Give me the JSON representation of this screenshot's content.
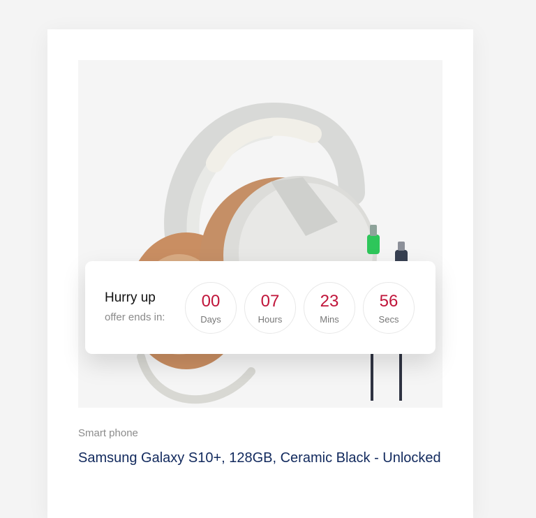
{
  "product": {
    "category": "Smart phone",
    "title": "Samsung Galaxy S10+, 128GB, Ceramic Black - Unlocked"
  },
  "countdown": {
    "title": "Hurry up",
    "subtitle": "offer ends in:",
    "days": {
      "value": "00",
      "label": "Days"
    },
    "hours": {
      "value": "07",
      "label": "Hours"
    },
    "mins": {
      "value": "23",
      "label": "Mins"
    },
    "secs": {
      "value": "56",
      "label": "Secs"
    }
  },
  "colors": {
    "countdown_number": "#c0153a",
    "title": "#11295d"
  }
}
